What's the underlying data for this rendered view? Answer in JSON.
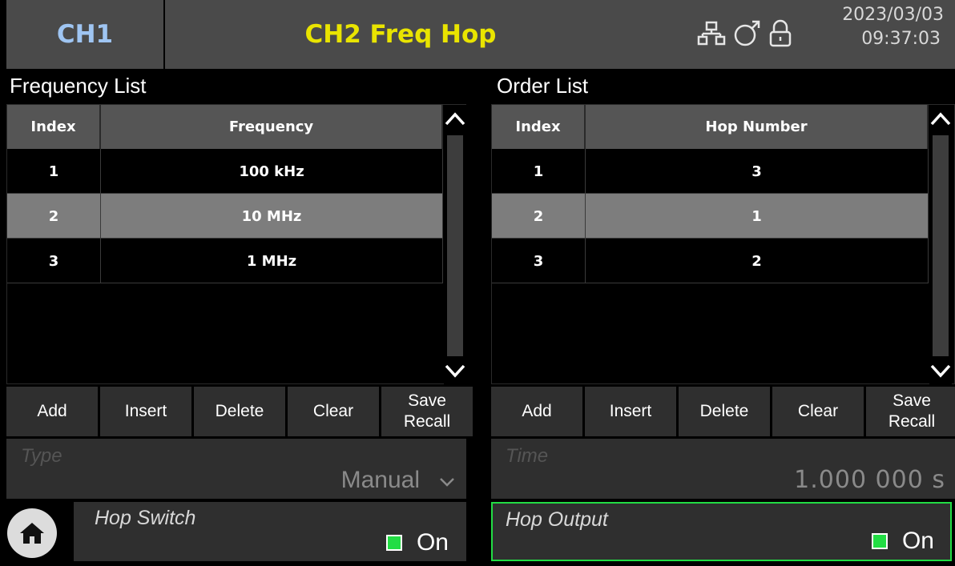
{
  "header": {
    "ch1_label": "CH1",
    "ch2_label": "CH2 Freq Hop",
    "date": "2023/03/03",
    "time": "09:37:03",
    "icons": [
      "network-icon",
      "remote-icon",
      "lock-icon"
    ]
  },
  "freq_panel": {
    "title": "Frequency List",
    "columns": [
      "Index",
      "Frequency"
    ],
    "rows": [
      {
        "index": "1",
        "value": "100 kHz"
      },
      {
        "index": "2",
        "value": "10 MHz"
      },
      {
        "index": "3",
        "value": "1 MHz"
      }
    ],
    "selected_row": 2
  },
  "order_panel": {
    "title": "Order List",
    "columns": [
      "Index",
      "Hop Number"
    ],
    "rows": [
      {
        "index": "1",
        "value": "3"
      },
      {
        "index": "2",
        "value": "1"
      },
      {
        "index": "3",
        "value": "2"
      }
    ],
    "selected_row": 2
  },
  "buttons": {
    "add": "Add",
    "insert": "Insert",
    "delete": "Delete",
    "clear": "Clear",
    "save": "Save",
    "recall": "Recall"
  },
  "type_field": {
    "label": "Type",
    "value": "Manual"
  },
  "time_field": {
    "label": "Time",
    "value": "1.000 000 s"
  },
  "hop_switch": {
    "label": "Hop Switch",
    "state": "On"
  },
  "hop_output": {
    "label": "Hop Output",
    "state": "On"
  },
  "colors": {
    "ch1": "#9fc5f2",
    "ch2": "#e9e400",
    "on_led": "#22dd44",
    "focus_border": "#22dd44"
  }
}
